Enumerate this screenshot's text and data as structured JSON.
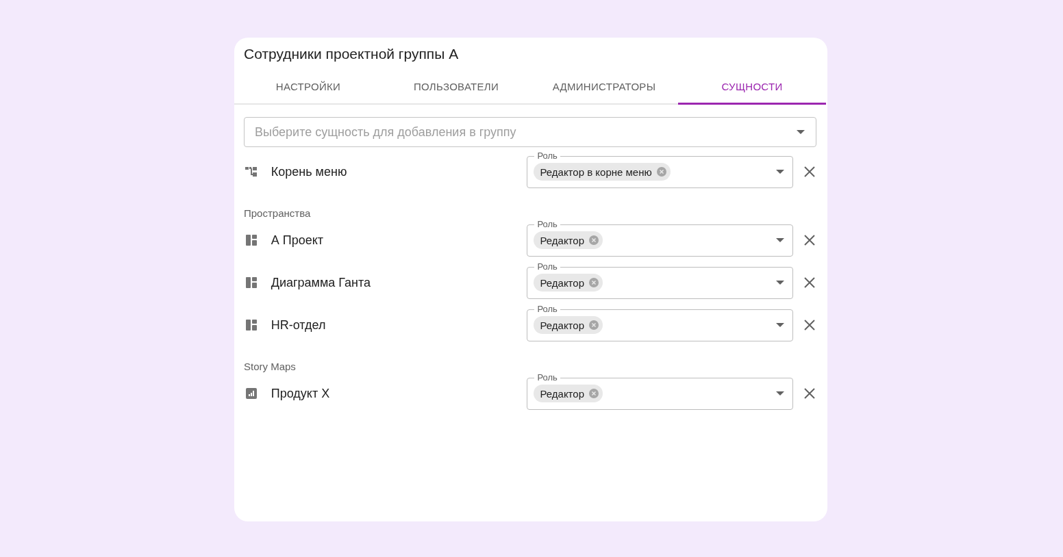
{
  "dialog": {
    "title": "Сотрудники проектной группы А"
  },
  "tabs": [
    {
      "label": "НАСТРОЙКИ",
      "selected": false
    },
    {
      "label": "ПОЛЬЗОВАТЕЛИ",
      "selected": false
    },
    {
      "label": "АДМИНИСТРАТОРЫ",
      "selected": false
    },
    {
      "label": "СУЩНОСТИ",
      "selected": true
    }
  ],
  "entity_select": {
    "placeholder": "Выберите сущность для добавления в группу"
  },
  "sections": [
    {
      "entities": [
        {
          "kind": "menu-root",
          "name": "Корень меню",
          "role_label": "Роль",
          "role": "Редактор в корне меню"
        }
      ]
    },
    {
      "heading": "Пространства",
      "entities": [
        {
          "kind": "space",
          "name": "А Проект",
          "role_label": "Роль",
          "role": "Редактор"
        },
        {
          "kind": "space",
          "name": "Диаграмма Ганта",
          "role_label": "Роль",
          "role": "Редактор"
        },
        {
          "kind": "space",
          "name": "HR-отдел",
          "role_label": "Роль",
          "role": "Редактор"
        }
      ]
    },
    {
      "heading": "Story Maps",
      "entities": [
        {
          "kind": "story-map",
          "name": "Продукт X",
          "role_label": "Роль",
          "role": "Редактор"
        }
      ]
    }
  ]
}
